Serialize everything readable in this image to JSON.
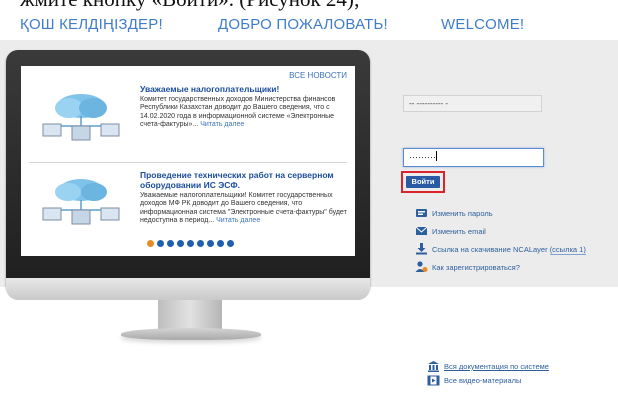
{
  "caption": "жмите кнопку «Войти». (Рисунок 24);",
  "welcome": [
    "ҚОШ КЕЛДІҢІЗДЕР!",
    "ДОБРО ПОЖАЛОВАТЬ!",
    "WELCOME!"
  ],
  "news": {
    "all_news": "ВСЕ НОВОСТИ",
    "items": [
      {
        "title": "Уважаемые налогоплательщики!",
        "text": "Комитет государственных доходов Министерства финансов Республики Казахстан доводит до Вашего сведения, что с 14.02.2020 года в информационной системе «Электронные счета-фактуры»...",
        "read_more": "Читать далее"
      },
      {
        "title": "Проведение технических работ на серверном оборудовании ИС ЭСФ.",
        "text": "Уважаемые налогоплательщики! Комитет государственных доходов МФ РК доводит до Вашего сведения, что информационная система \"Электронные счета-фактуры\" будет недоступна в период...",
        "read_more": "Читать далее"
      }
    ],
    "slide_count": 9,
    "active_slide": 0
  },
  "login": {
    "login_value": "-- ---------- -",
    "password_value": "·········",
    "submit_label": "Войти"
  },
  "links": {
    "change_password": "Изменить пароль",
    "change_email": "Изменить email",
    "ncalayer": "Ссылка на скачивание NCALayer",
    "ncalayer_alt": "(ссылка 1)",
    "register": "Как зарегистрироваться?"
  },
  "docs": {
    "all_docs": "Вся документация по системе",
    "all_videos": "Все видео-материалы"
  },
  "colors": {
    "accent": "#2a5aa3",
    "link": "#2d5f9e",
    "highlight": "#d9242b",
    "active_dot": "#e88c22"
  }
}
